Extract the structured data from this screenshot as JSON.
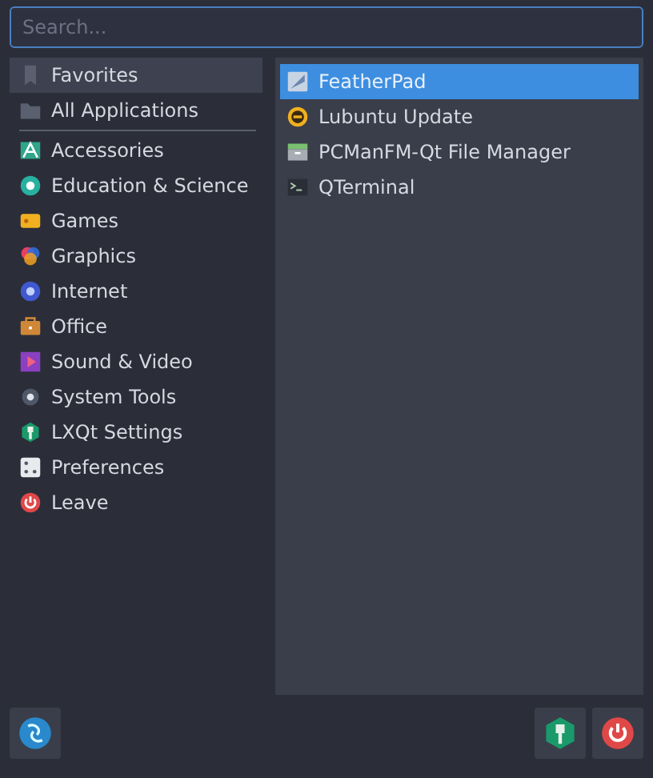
{
  "search": {
    "placeholder": "Search..."
  },
  "sidebar": {
    "places": [
      {
        "label": "Favorites",
        "selected": true
      },
      {
        "label": "All Applications",
        "selected": false
      }
    ],
    "categories": [
      {
        "label": "Accessories",
        "selected": false
      },
      {
        "label": "Education & Science",
        "selected": false
      },
      {
        "label": "Games",
        "selected": false
      },
      {
        "label": "Graphics",
        "selected": false
      },
      {
        "label": "Internet",
        "selected": false
      },
      {
        "label": "Office",
        "selected": false
      },
      {
        "label": "Sound & Video",
        "selected": false
      },
      {
        "label": "System Tools",
        "selected": false
      },
      {
        "label": "LXQt Settings",
        "selected": false
      },
      {
        "label": "Preferences",
        "selected": false
      },
      {
        "label": "Leave",
        "selected": false
      }
    ]
  },
  "apps": [
    {
      "label": "FeatherPad",
      "selected": true
    },
    {
      "label": "Lubuntu Update",
      "selected": false
    },
    {
      "label": "PCManFM-Qt File Manager",
      "selected": false
    },
    {
      "label": "QTerminal",
      "selected": false
    }
  ]
}
